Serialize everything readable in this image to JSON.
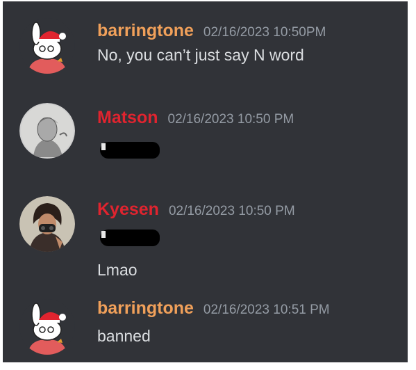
{
  "messages": [
    {
      "author": "barringtone",
      "author_color": "#f0a05a",
      "timestamp": "02/16/2023 10:50PM",
      "lines": [
        "No, you can’t just say N word"
      ]
    },
    {
      "author": "Matson",
      "author_color": "#e0242f",
      "timestamp": "02/16/2023 10:50 PM",
      "lines": []
    },
    {
      "author": "Kyesen",
      "author_color": "#e0242f",
      "timestamp": "02/16/2023 10:50 PM",
      "lines": [
        "Lmao"
      ]
    },
    {
      "author": "barringtone",
      "author_color": "#f0a05a",
      "timestamp": "02/16/2023 10:51 PM",
      "lines": [
        "banned"
      ]
    }
  ],
  "avatars": [
    "cartoon-rabbit-santa-hat",
    "grey-sketch-portrait",
    "masked-character-portrait",
    "cartoon-rabbit-santa-hat"
  ],
  "colors": {
    "background": "#313338",
    "timestamp": "#949ba4",
    "text": "#dbdee1"
  }
}
